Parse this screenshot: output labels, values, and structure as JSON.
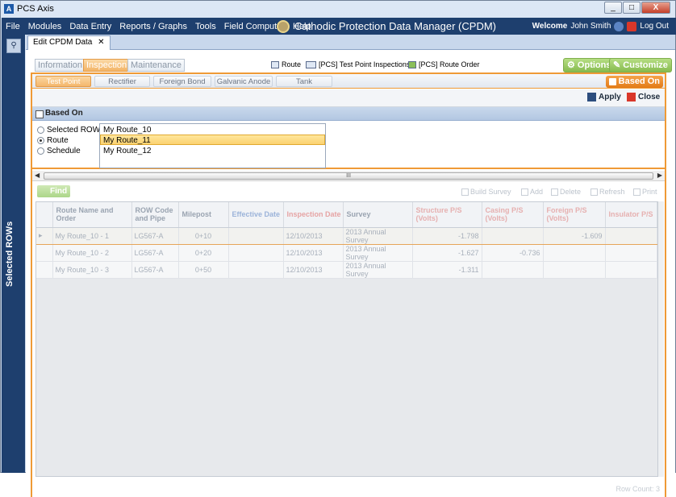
{
  "window": {
    "title": "PCS Axis",
    "controls": [
      "_",
      "□",
      "X"
    ]
  },
  "menu": [
    "File",
    "Modules",
    "Data Entry",
    "Reports / Graphs",
    "Tools",
    "Field Computer",
    "Help"
  ],
  "app_title": "Cathodic Protection Data Manager (CPDM)",
  "user": {
    "welcome": "Welcome",
    "name": "John Smith",
    "logout": "Log Out"
  },
  "left_panel": {
    "label": "Selected ROWs"
  },
  "doc_tab": {
    "label": "Edit CPDM Data",
    "close": "✕"
  },
  "category_tabs": [
    "Information",
    "Inspection",
    "Maintenance"
  ],
  "toolbar_links": [
    "Route",
    "[PCS] Test Point Inspections",
    "[PCS] Route Order"
  ],
  "options_label": "Options",
  "customize_label": "Customize",
  "sub_tabs": [
    "Test Point",
    "Rectifier",
    "Foreign Bond",
    "Galvanic Anode",
    "Tank"
  ],
  "based_on_button": "Based On",
  "panel": {
    "apply": "Apply",
    "close": "Close",
    "header": "Based On",
    "radios": [
      "Selected ROWs",
      "Route",
      "Schedule"
    ],
    "routes": [
      "My Route_10",
      "My Route_11",
      "My Route_12"
    ]
  },
  "scroll_label": "III",
  "grid": {
    "find": "Find",
    "tools": [
      "Build Survey",
      "Add",
      "Delete",
      "Refresh",
      "Print"
    ],
    "columns": [
      "Route Name and Order",
      "ROW Code and Pipe",
      "Milepost",
      "Effective Date",
      "Inspection Date",
      "Survey",
      "Structure P/S (Volts)",
      "Casing P/S (Volts)",
      "Foreign P/S (Volts)",
      "Insulator P/S"
    ],
    "rows": [
      [
        "My Route_10 - 1",
        "LG567-A",
        "0+10",
        "",
        "12/10/2013",
        "2013 Annual Survey",
        "-1.798",
        "",
        "-1.609",
        ""
      ],
      [
        "My Route_10 - 2",
        "LG567-A",
        "0+20",
        "",
        "12/10/2013",
        "2013 Annual Survey",
        "-1.627",
        "-0.736",
        "",
        ""
      ],
      [
        "My Route_10 - 3",
        "LG567-A",
        "0+50",
        "",
        "12/10/2013",
        "2013 Annual Survey",
        "-1.311",
        "",
        "",
        ""
      ]
    ],
    "row_count": "Row Count: 3"
  },
  "colors": {
    "navy": "#1e3f6e",
    "accent": "#ef9a36",
    "green": "#86bb4f"
  }
}
